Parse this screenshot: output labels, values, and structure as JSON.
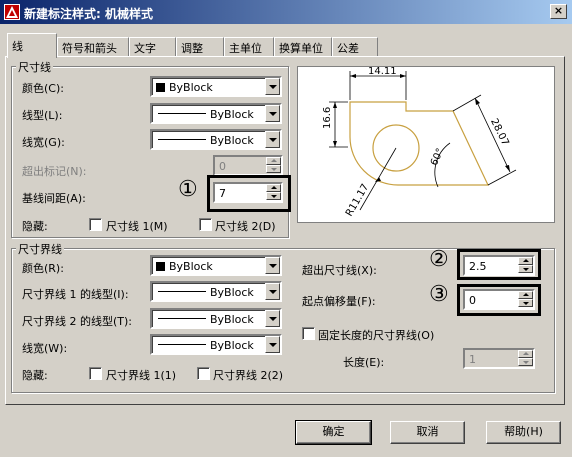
{
  "window": {
    "title": "新建标注样式: 机械样式",
    "close_label": "×"
  },
  "tabs": [
    {
      "label": "线"
    },
    {
      "label": "符号和箭头"
    },
    {
      "label": "文字"
    },
    {
      "label": "调整"
    },
    {
      "label": "主单位"
    },
    {
      "label": "换算单位"
    },
    {
      "label": "公差"
    }
  ],
  "dim_lines": {
    "group_label": "尺寸线",
    "color_label": "颜色(C):",
    "color_value": "ByBlock",
    "linetype_label": "线型(L):",
    "linetype_value": "ByBlock",
    "lineweight_label": "线宽(G):",
    "lineweight_value": "ByBlock",
    "extend_ticks_label": "超出标记(N):",
    "extend_ticks_value": "0",
    "baseline_spacing_label": "基线间距(A):",
    "baseline_spacing_value": "7",
    "suppress_label": "隐藏:",
    "suppress_1_label": "尺寸线 1(M)",
    "suppress_2_label": "尺寸线 2(D)"
  },
  "ext_lines": {
    "group_label": "尺寸界线",
    "color_label": "颜色(R):",
    "color_value": "ByBlock",
    "linetype1_label": "尺寸界线 1 的线型(I):",
    "linetype1_value": "ByBlock",
    "linetype2_label": "尺寸界线 2 的线型(T):",
    "linetype2_value": "ByBlock",
    "lineweight_label": "线宽(W):",
    "lineweight_value": "ByBlock",
    "suppress_label": "隐藏:",
    "suppress_1_label": "尺寸界线 1(1)",
    "suppress_2_label": "尺寸界线 2(2)",
    "extend_beyond_label": "超出尺寸线(X):",
    "extend_beyond_value": "2.5",
    "offset_label": "起点偏移量(F):",
    "offset_value": "0",
    "fixed_length_label": "固定长度的尺寸界线(O)",
    "length_label": "长度(E):",
    "length_value": "1"
  },
  "callouts": [
    "①",
    "②",
    "③"
  ],
  "preview": {
    "dim_top": "14.11",
    "dim_left": "16.6",
    "dim_right": "28.07",
    "dim_angle": "60°",
    "dim_radius": "R11.17"
  },
  "buttons": {
    "ok": "确定",
    "cancel": "取消",
    "help": "帮助(H)"
  },
  "colors": {
    "titlebar_start": "#0a246a",
    "titlebar_end": "#a6caf0",
    "face": "#d4d0c8",
    "preview_shape": "#c8a040"
  }
}
